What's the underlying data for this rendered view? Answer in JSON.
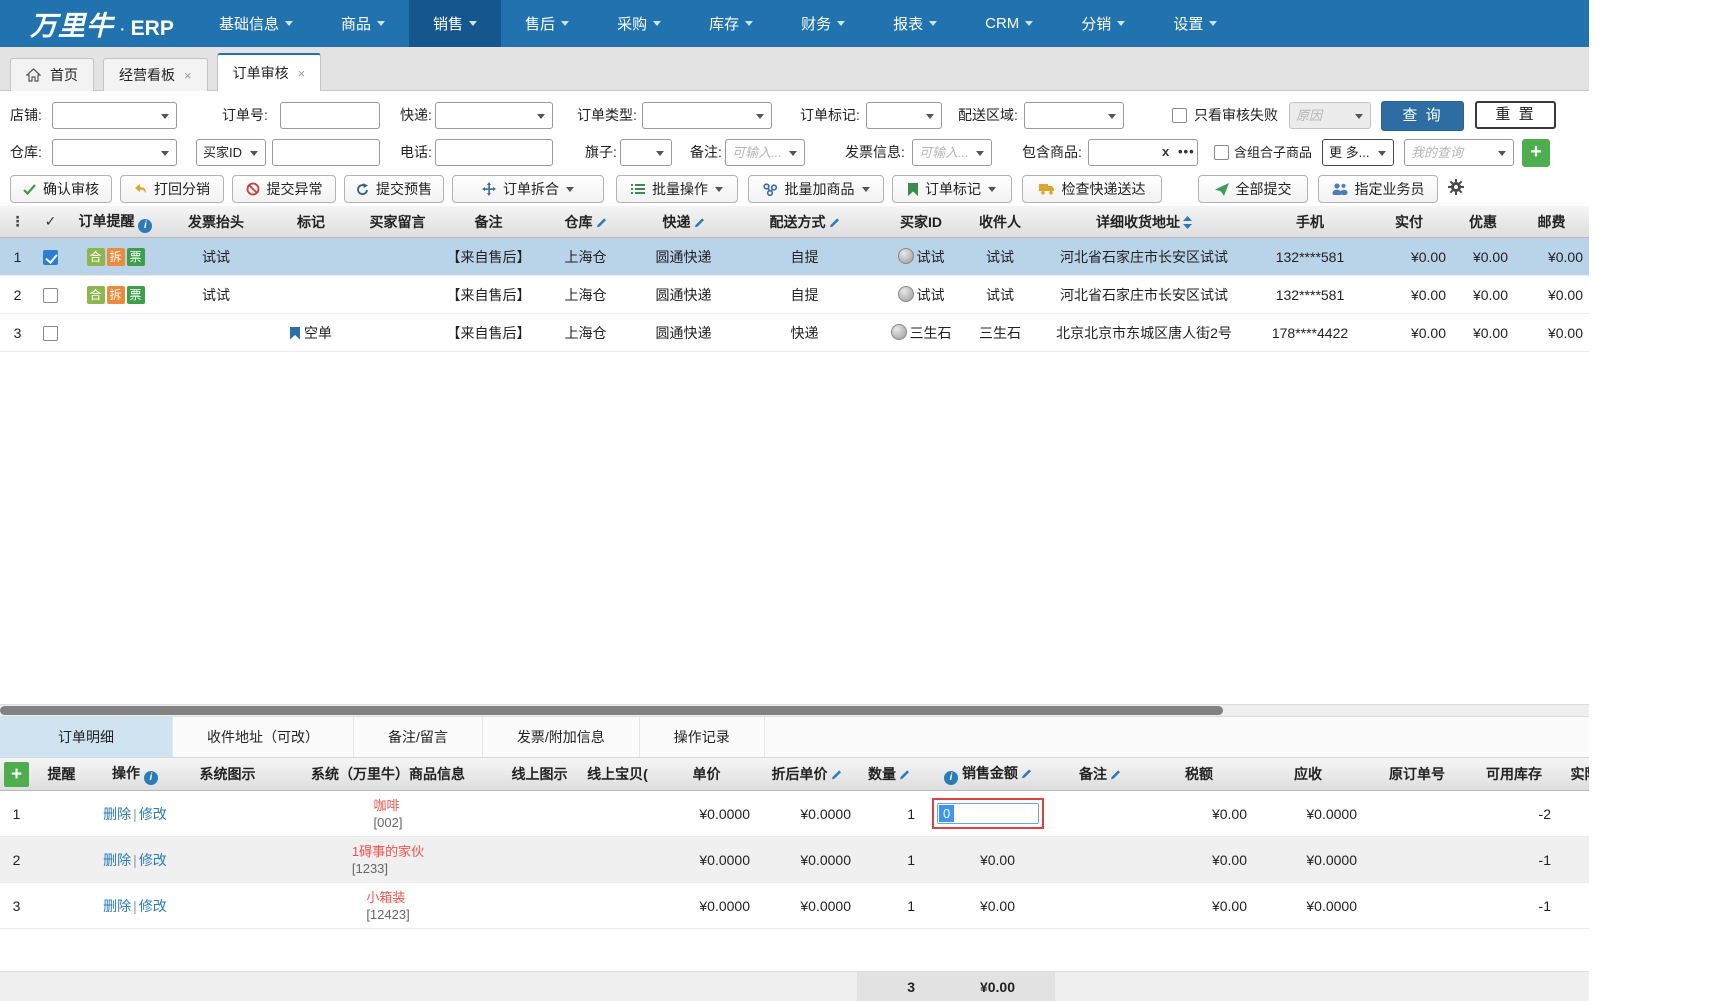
{
  "colors": {
    "nav_blue": "#2173b0",
    "nav_active": "#15578c",
    "accent": "#2e6da4",
    "green": "#4cae4c",
    "link": "#2b7bb9",
    "selected_row": "#b9d4e9",
    "product_red": "#f0524a",
    "edit_border_red": "#e04040",
    "badge_merge": "#8db74d",
    "badge_split": "#ee8a3c",
    "badge_ticket": "#3f9e49"
  },
  "nav": {
    "logo_main": "万里牛",
    "logo_dot": "·",
    "logo_sub": "ERP",
    "items": [
      "基础信息",
      "商品",
      "销售",
      "售后",
      "采购",
      "库存",
      "财务",
      "报表",
      "CRM",
      "分销",
      "设置"
    ],
    "active_item": "销售"
  },
  "window_tabs": {
    "home": "首页",
    "dashboard": "经营看板",
    "current": "订单审核"
  },
  "filters": {
    "shop_label": "店铺:",
    "order_no_label": "订单号:",
    "express_label": "快递:",
    "order_type_label": "订单类型:",
    "order_mark_label": "订单标记:",
    "delivery_area_label": "配送区域:",
    "only_failed_label": "只看审核失败",
    "reason_placeholder": "原因",
    "query_btn": "查 询",
    "reset_btn": "重 置",
    "warehouse_label": "仓库:",
    "buyer_id_label": "买家ID",
    "phone_label": "电话:",
    "flag_label": "旗子:",
    "remark_label": "备注:",
    "remark_placeholder": "可输入...",
    "invoice_label": "发票信息:",
    "invoice_placeholder": "可输入...",
    "include_product_label": "包含商品:",
    "clear_x": "x",
    "more_dots": "•••",
    "include_sub_label": "含组合子商品",
    "more_btn": "更 多...",
    "my_query_placeholder": "我的查询",
    "add_btn": "+"
  },
  "toolbar": {
    "confirm": "确认审核",
    "return_dist": "打回分销",
    "submit_abnormal": "提交异常",
    "submit_presale": "提交预售",
    "split_merge": "订单拆合",
    "batch_ops": "批量操作",
    "batch_add": "批量加商品",
    "order_mark": "订单标记",
    "check_delivery": "检查快递送达",
    "submit_all": "全部提交",
    "assign_salesman": "指定业务员"
  },
  "orders": {
    "headers": {
      "remind": "订单提醒",
      "invoice": "发票抬头",
      "mark": "标记",
      "buyer_msg": "买家留言",
      "remark": "备注",
      "warehouse": "仓库",
      "express": "快递",
      "delivery": "配送方式",
      "buyer_id": "买家ID",
      "receiver": "收件人",
      "address": "详细收货地址",
      "phone": "手机",
      "paid": "实付",
      "discount": "优惠",
      "postage": "邮费"
    },
    "badges": {
      "merge": "合",
      "split": "拆",
      "ticket": "票"
    },
    "rows": [
      {
        "num": "1",
        "invoice": "试试",
        "mark": "",
        "buyer_msg": "",
        "remark": "【来自售后】",
        "warehouse": "上海仓",
        "express": "圆通快递",
        "delivery": "自提",
        "buyer_id": "试试",
        "receiver": "试试",
        "address": "河北省石家庄市长安区试试",
        "phone": "132****581",
        "paid": "¥0.00",
        "discount": "¥0.00",
        "postage": "¥0.00"
      },
      {
        "num": "2",
        "invoice": "试试",
        "mark": "",
        "buyer_msg": "",
        "remark": "【来自售后】",
        "warehouse": "上海仓",
        "express": "圆通快递",
        "delivery": "自提",
        "buyer_id": "试试",
        "receiver": "试试",
        "address": "河北省石家庄市长安区试试",
        "phone": "132****581",
        "paid": "¥0.00",
        "discount": "¥0.00",
        "postage": "¥0.00"
      },
      {
        "num": "3",
        "invoice": "",
        "mark": "空单",
        "buyer_msg": "",
        "remark": "【来自售后】",
        "warehouse": "上海仓",
        "express": "圆通快递",
        "delivery": "快递",
        "buyer_id": "三生石",
        "receiver": "三生石",
        "address": "北京北京市东城区唐人街2号",
        "phone": "178****4422",
        "paid": "¥0.00",
        "discount": "¥0.00",
        "postage": "¥0.00"
      }
    ]
  },
  "detail": {
    "tabs": [
      "订单明细",
      "收件地址（可改）",
      "备注/留言",
      "发票/附加信息",
      "操作记录"
    ],
    "headers": {
      "remind": "提醒",
      "ops": "操作",
      "sys_img": "系统图示",
      "sys_info": "系统（万里牛）商品信息",
      "online_img": "线上图示",
      "online_item": "线上宝贝(",
      "unit_price": "单价",
      "disc_price": "折后单价",
      "qty": "数量",
      "sale_amount": "销售金额",
      "remark": "备注",
      "tax": "税额",
      "receivable": "应收",
      "orig_order": "原订单号",
      "stock": "可用库存",
      "actual": "实际"
    },
    "ops": {
      "del": "删除",
      "sep": "|",
      "edit": "修改"
    },
    "rows": [
      {
        "num": "1",
        "name": "咖啡",
        "code": "[002]",
        "unit_price": "¥0.0000",
        "disc_price": "¥0.0000",
        "qty": "1",
        "sale_amount": "0",
        "remark": "",
        "tax": "¥0.00",
        "receivable": "¥0.0000",
        "orig_order": "",
        "stock": "-2"
      },
      {
        "num": "2",
        "name": "1碍事的家伙",
        "code": "[1233]",
        "unit_price": "¥0.0000",
        "disc_price": "¥0.0000",
        "qty": "1",
        "sale_amount": "¥0.00",
        "remark": "",
        "tax": "¥0.00",
        "receivable": "¥0.0000",
        "orig_order": "",
        "stock": "-1"
      },
      {
        "num": "3",
        "name": "小箱装",
        "code": "[12423]",
        "unit_price": "¥0.0000",
        "disc_price": "¥0.0000",
        "qty": "1",
        "sale_amount": "¥0.00",
        "remark": "",
        "tax": "¥0.00",
        "receivable": "¥0.0000",
        "orig_order": "",
        "stock": "-1"
      }
    ],
    "footer": {
      "qty_total": "3",
      "amount_total": "¥0.00"
    }
  }
}
